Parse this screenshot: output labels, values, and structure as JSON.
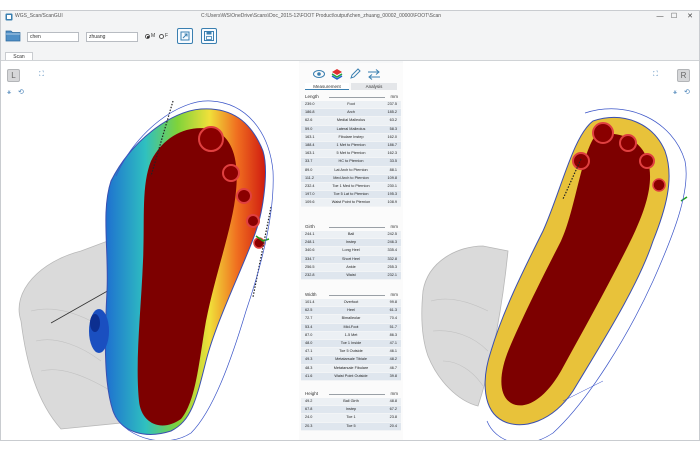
{
  "window": {
    "app_title": "WGS_Scan/ScanGUI",
    "file_path": "C:\\Users\\WS\\OneDrive\\Scans\\Doc_2015-12\\FOOT Product\\output\\chen_zhuang_00002_00000\\FOOT\\Scan",
    "minimize": "—",
    "maximize": "☐",
    "close": "✕"
  },
  "toolbar": {
    "first_name": "chen",
    "last_name": "zhuang",
    "radio_m": "M",
    "radio_f": "F"
  },
  "tabs": [
    {
      "label": "Scan"
    }
  ],
  "left_view": {
    "side_label": "L"
  },
  "right_view": {
    "side_label": "R"
  },
  "panel": {
    "tab_measurement": "Measurement",
    "tab_analysis": "Analysis",
    "sections": [
      {
        "title": "Length",
        "unit": "mm",
        "rows": [
          {
            "left": "239.0",
            "name": "Foot",
            "right": "237.5"
          },
          {
            "left": "186.8",
            "name": "Arch",
            "right": "185.2"
          },
          {
            "left": "62.6",
            "name": "Medial Malleolus",
            "right": "63.2"
          },
          {
            "left": "59.0",
            "name": "Lateral Malleolus",
            "right": "58.3"
          },
          {
            "left": "163.1",
            "name": "Fibulare Instep",
            "right": "162.0"
          },
          {
            "left": "188.4",
            "name": "1 Met to Pternion",
            "right": "186.7"
          },
          {
            "left": "163.1",
            "name": "5 Met to Pternion",
            "right": "162.3"
          },
          {
            "left": "33.7",
            "name": "HC to Pternion",
            "right": "33.5"
          },
          {
            "left": "89.0",
            "name": "Lat Arch to Pternion",
            "right": "88.1"
          },
          {
            "left": "111.2",
            "name": "Med Arch to Pternion",
            "right": "109.8"
          },
          {
            "left": "232.4",
            "name": "Toe 1 Med to Pternion",
            "right": "230.1"
          },
          {
            "left": "197.0",
            "name": "Toe 5 Lat to Pternion",
            "right": "195.3"
          },
          {
            "left": "109.6",
            "name": "Waist Point to Pternion",
            "right": "108.9"
          }
        ]
      },
      {
        "title": "Girth",
        "unit": "mm",
        "rows": [
          {
            "left": "244.1",
            "name": "Ball",
            "right": "242.5"
          },
          {
            "left": "248.1",
            "name": "Instep",
            "right": "246.3"
          },
          {
            "left": "340.6",
            "name": "Long Heel",
            "right": "335.4"
          },
          {
            "left": "334.7",
            "name": "Short Heel",
            "right": "332.8"
          },
          {
            "left": "256.5",
            "name": "Ankle",
            "right": "255.3"
          },
          {
            "left": "232.8",
            "name": "Waist",
            "right": "232.1"
          }
        ]
      },
      {
        "title": "Width",
        "unit": "mm",
        "rows": [
          {
            "left": "101.4",
            "name": "Overfoot",
            "right": "99.8"
          },
          {
            "left": "62.5",
            "name": "Heel",
            "right": "61.3"
          },
          {
            "left": "72.7",
            "name": "Bimalleolar",
            "right": "70.4"
          },
          {
            "left": "53.4",
            "name": "Mid-Foot",
            "right": "51.7"
          },
          {
            "left": "87.0",
            "name": "1-5 Met",
            "right": "86.3"
          },
          {
            "left": "48.0",
            "name": "Toe 1 Inside",
            "right": "47.1"
          },
          {
            "left": "47.1",
            "name": "Toe 5 Outside",
            "right": "46.1"
          },
          {
            "left": "49.3",
            "name": "Metatarsale Tibiale",
            "right": "48.2"
          },
          {
            "left": "48.3",
            "name": "Metatarsale Fibulare",
            "right": "46.7"
          },
          {
            "left": "41.6",
            "name": "Waist Point Outside",
            "right": "39.8"
          }
        ]
      },
      {
        "title": "Height",
        "unit": "mm",
        "rows": [
          {
            "left": "49.2",
            "name": "Ball Girth",
            "right": "48.8"
          },
          {
            "left": "67.8",
            "name": "Instep",
            "right": "67.2"
          },
          {
            "left": "24.0",
            "name": "Toe 1",
            "right": "23.8"
          },
          {
            "left": "20.3",
            "name": "Toe 5",
            "right": "20.4"
          }
        ]
      }
    ]
  },
  "colors": {
    "pressure_high": "#7d0000",
    "pressure_mid": "#e8d040",
    "pressure_low": "#1e4fbf",
    "mesh": "#d8d8d8",
    "accent": "#3a7fb0"
  }
}
